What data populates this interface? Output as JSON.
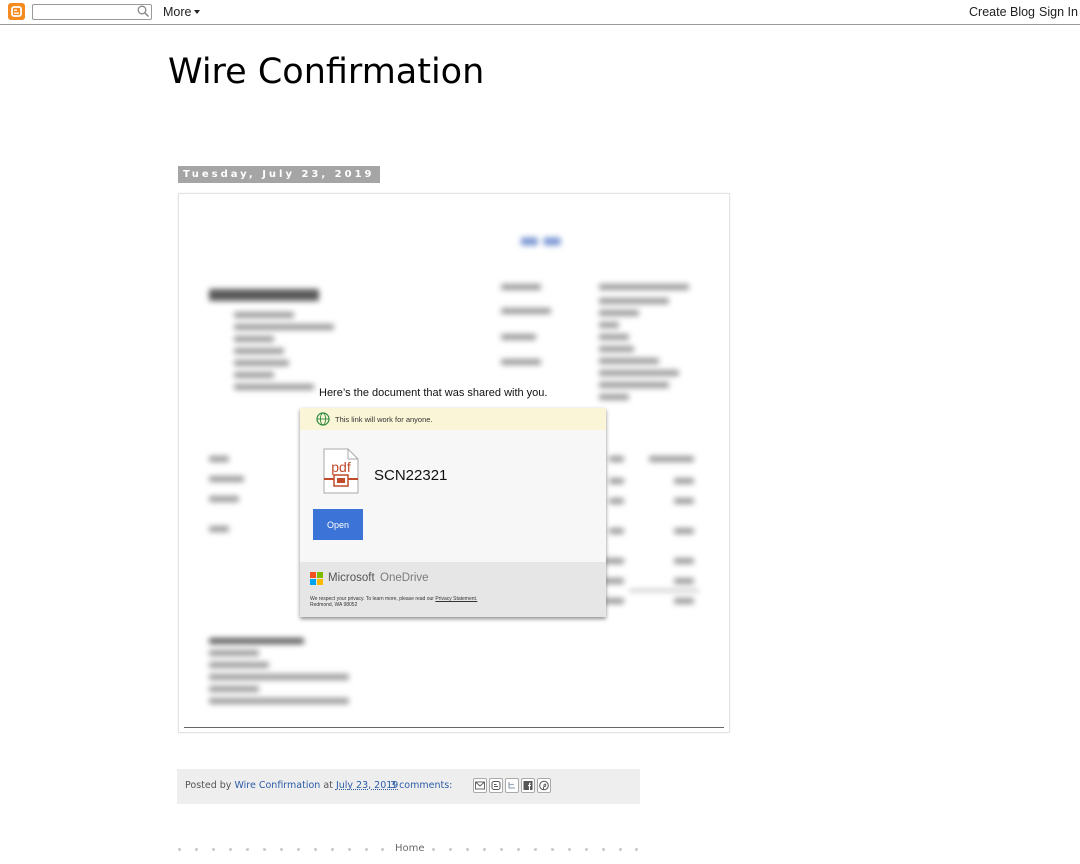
{
  "navbar": {
    "search_value": "",
    "more_label": "More",
    "create_blog_label": "Create Blog",
    "sign_in_label": "Sign In"
  },
  "blog": {
    "title": "Wire Confirmation"
  },
  "post": {
    "date_header": "Tuesday, July 23, 2019",
    "share_card": {
      "heading": "Here’s the document that was shared with you.",
      "link_notice": "This link will work for anyone.",
      "file_icon_label": "pdf",
      "file_name": "SCN22321",
      "open_label": "Open",
      "brand_microsoft": "Microsoft",
      "brand_product": "OneDrive",
      "privacy_prefix": "We respect your privacy. To learn more, please read our",
      "privacy_link": "Privacy Statement.",
      "address": "Redmond, WA 98052"
    },
    "footer": {
      "posted_by_prefix": "Posted by",
      "author": "Wire Confirmation",
      "at": "at",
      "date": "July 23, 2019",
      "comments": "3 comments:"
    },
    "share_icons": [
      "email-icon",
      "blogger-icon",
      "twitter-icon",
      "facebook-icon",
      "pinterest-icon"
    ]
  },
  "pager": {
    "home_label": "Home"
  },
  "colors": {
    "blogger_orange": "#f58a1f",
    "link_blue": "#2c5ca8",
    "open_button": "#3c73d6",
    "date_header_bg": "#a5a5a5"
  }
}
